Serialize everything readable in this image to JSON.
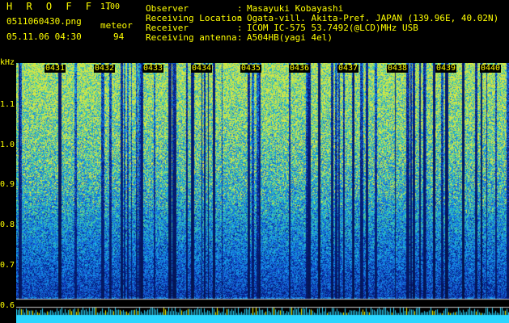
{
  "header": {
    "title": "H R O F F T",
    "version": "1.00",
    "filename": "0511060430.png",
    "datetime": "05.11.06 04:30",
    "meteor_label": "meteor",
    "meteor_count": "94"
  },
  "info": [
    {
      "label": "Observer",
      "value": "Masayuki Kobayashi"
    },
    {
      "label": "Receiving Location",
      "value": "Ogata-vill. Akita-Pref. JAPAN (139.96E, 40.02N)"
    },
    {
      "label": "Receiver",
      "value": "ICOM IC-575 53.7492(@LCD)MHz USB"
    },
    {
      "label": "Receiving antenna",
      "value": "A504HB(yagi 4el)"
    }
  ],
  "chart_data": {
    "type": "heatmap",
    "ylabel": "kHz",
    "yticks": [
      "1.1",
      "1.0",
      "0.9",
      "0.8",
      "0.7",
      "0.6"
    ],
    "xticks": [
      "0431",
      "0432",
      "0433",
      "0434",
      "0435",
      "0436",
      "0437",
      "0438",
      "0439",
      "0440"
    ],
    "colors": {
      "background": "#000000",
      "low": "#0a1a6e",
      "mid": "#1e5be0",
      "high": "#22d3a0",
      "peak": "#d8e84a",
      "text": "#ffff00"
    }
  }
}
